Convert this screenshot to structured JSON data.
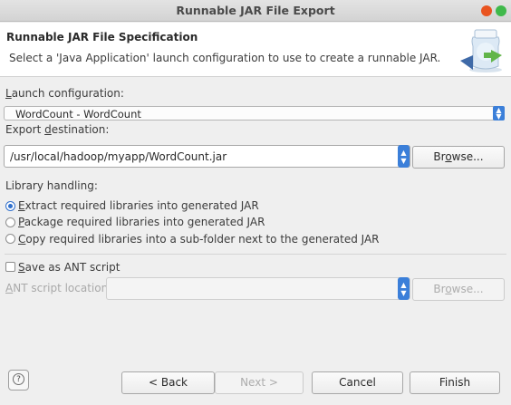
{
  "window": {
    "title": "Runnable JAR File Export"
  },
  "header": {
    "title": "Runnable JAR File Specification",
    "description": "Select a 'Java Application' launch configuration to use to create a runnable JAR."
  },
  "launch_configuration": {
    "label_mnemonic": "L",
    "label_rest": "aunch configuration:",
    "value": "WordCount - WordCount"
  },
  "export_destination": {
    "label_prefix": "Export ",
    "label_mnemonic": "d",
    "label_rest": "estination:",
    "value": "/usr/local/hadoop/myapp/WordCount.jar",
    "browse_prefix": "Br",
    "browse_mnemonic": "o",
    "browse_rest": "wse..."
  },
  "library_handling": {
    "label": "Library handling:",
    "options": [
      {
        "mnemonic": "E",
        "rest": "xtract required libraries into generated JAR",
        "selected": true
      },
      {
        "mnemonic": "P",
        "rest": "ackage required libraries into generated JAR",
        "selected": false
      },
      {
        "mnemonic": "C",
        "rest": "opy required libraries into a sub-folder next to the generated JAR",
        "selected": false
      }
    ]
  },
  "ant": {
    "save_mnemonic": "S",
    "save_rest": "ave as ANT script",
    "checked": false,
    "location_mnemonic": "A",
    "location_rest": "NT script location:",
    "location_value": "",
    "browse_prefix": "Br",
    "browse_mnemonic": "o",
    "browse_rest": "wse..."
  },
  "footer": {
    "help_label": "?",
    "back_label": "< Back",
    "next_label": "Next >",
    "cancel_label": "Cancel",
    "finish_label": "Finish"
  },
  "colors": {
    "accent": "#3b7fd9",
    "close_button": "#e95420",
    "maximize_button": "#3fb94b"
  }
}
